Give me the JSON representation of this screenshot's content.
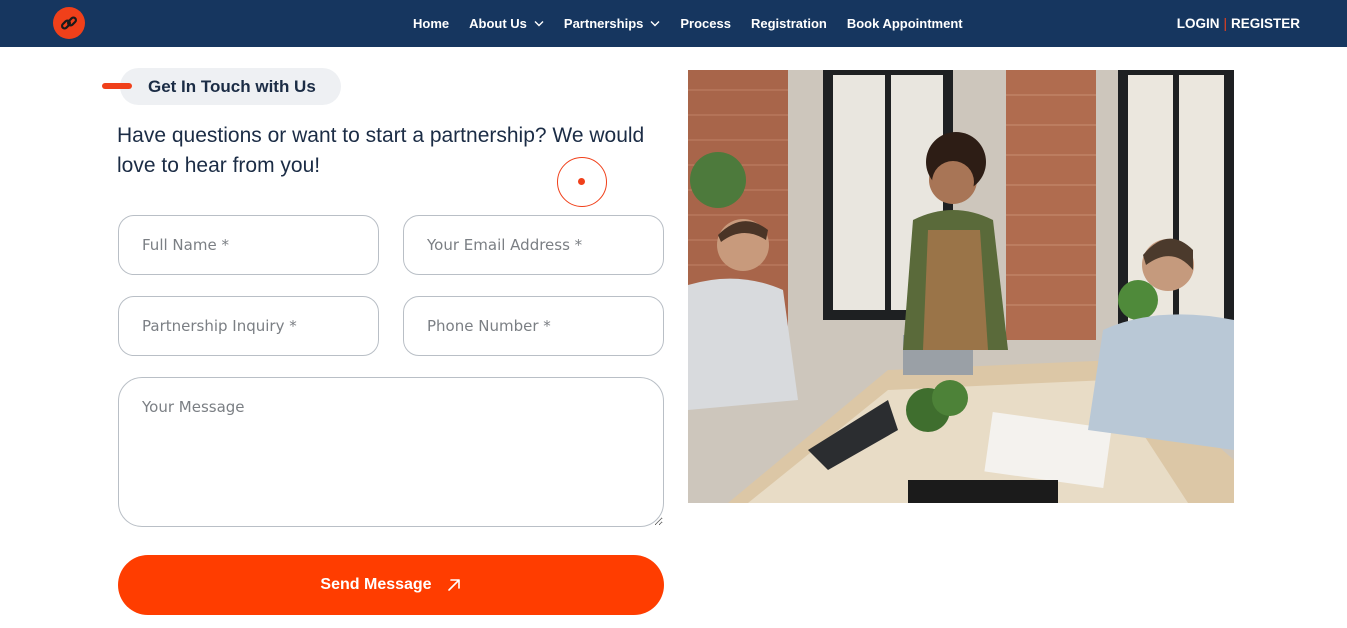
{
  "nav": {
    "items": [
      {
        "label": "Home",
        "dropdown": false
      },
      {
        "label": "About Us",
        "dropdown": true
      },
      {
        "label": "Partnerships",
        "dropdown": true
      },
      {
        "label": "Process",
        "dropdown": false
      },
      {
        "label": "Registration",
        "dropdown": false
      },
      {
        "label": "Book Appointment",
        "dropdown": false
      }
    ],
    "login": "LOGIN",
    "separator": "|",
    "register": "REGISTER"
  },
  "section": {
    "eyebrow": "Get In Touch with Us",
    "headline": "Have questions or want to start a partnership? We would love to hear from you!"
  },
  "form": {
    "full_name_placeholder": "Full Name *",
    "email_placeholder": "Your Email Address *",
    "inquiry_placeholder": "Partnership Inquiry *",
    "phone_placeholder": "Phone Number *",
    "message_placeholder": "Your Message",
    "submit_label": "Send Message"
  },
  "colors": {
    "nav_bg": "#16365f",
    "accent": "#ff3d00",
    "heading": "#1b2c45"
  }
}
